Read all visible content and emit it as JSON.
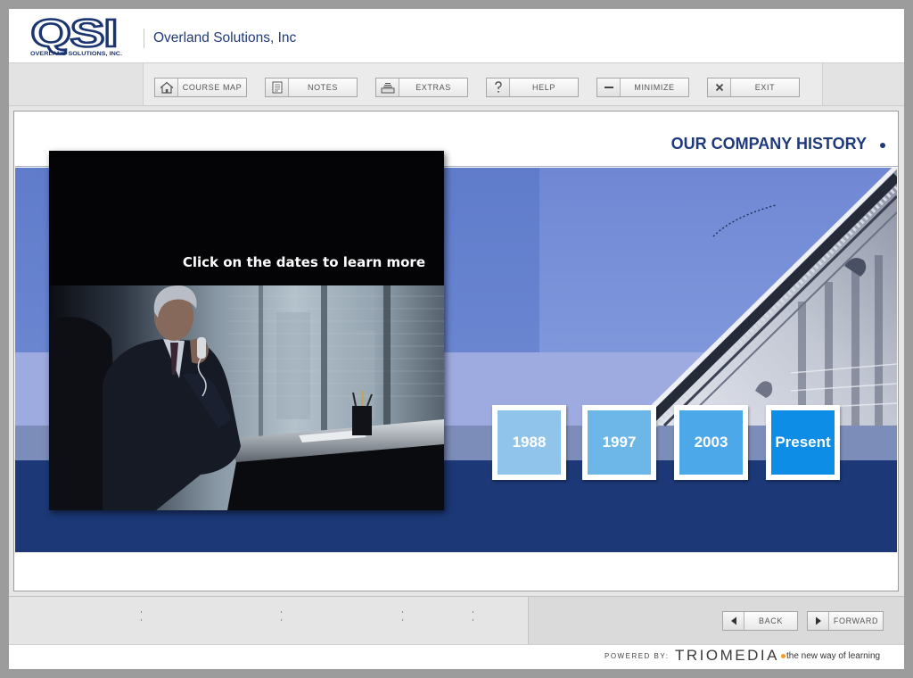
{
  "header": {
    "logo": {
      "mark": "QSI",
      "tagline": "OVERLAND SOLUTIONS, INC."
    },
    "company_name": "Overland Solutions, Inc"
  },
  "toolbar": {
    "buttons": [
      {
        "label": "COURSE MAP",
        "icon": "home-icon"
      },
      {
        "label": "NOTES",
        "icon": "document-icon"
      },
      {
        "label": "EXTRAS",
        "icon": "tray-icon"
      },
      {
        "label": "HELP",
        "icon": "question-icon"
      },
      {
        "label": "MINIMIZE",
        "icon": "minus-icon"
      },
      {
        "label": "EXIT",
        "icon": "close-icon"
      }
    ]
  },
  "content": {
    "title": "OUR COMPANY HISTORY",
    "instruction": "Click on the dates to learn more",
    "dates": [
      {
        "label": "1988",
        "color": "#90c4ea"
      },
      {
        "label": "1997",
        "color": "#6cb6e8"
      },
      {
        "label": "2003",
        "color": "#4ca8e8"
      },
      {
        "label": "Present",
        "color": "#0d8de5"
      }
    ]
  },
  "footer": {
    "back": {
      "label": "BACK",
      "icon": "arrow-left-icon"
    },
    "forward": {
      "label": "FORWARD",
      "icon": "arrow-right-icon"
    }
  },
  "branding": {
    "powered_by": "POWERED BY:",
    "brand": "TRIOMEDIA",
    "tagline": "the new way of learning"
  },
  "colors": {
    "navy": "#1f3a7a",
    "banner_blue": "#6a85d0",
    "banner_navy": "#1c3877",
    "brand_dot": "#f0a020"
  }
}
